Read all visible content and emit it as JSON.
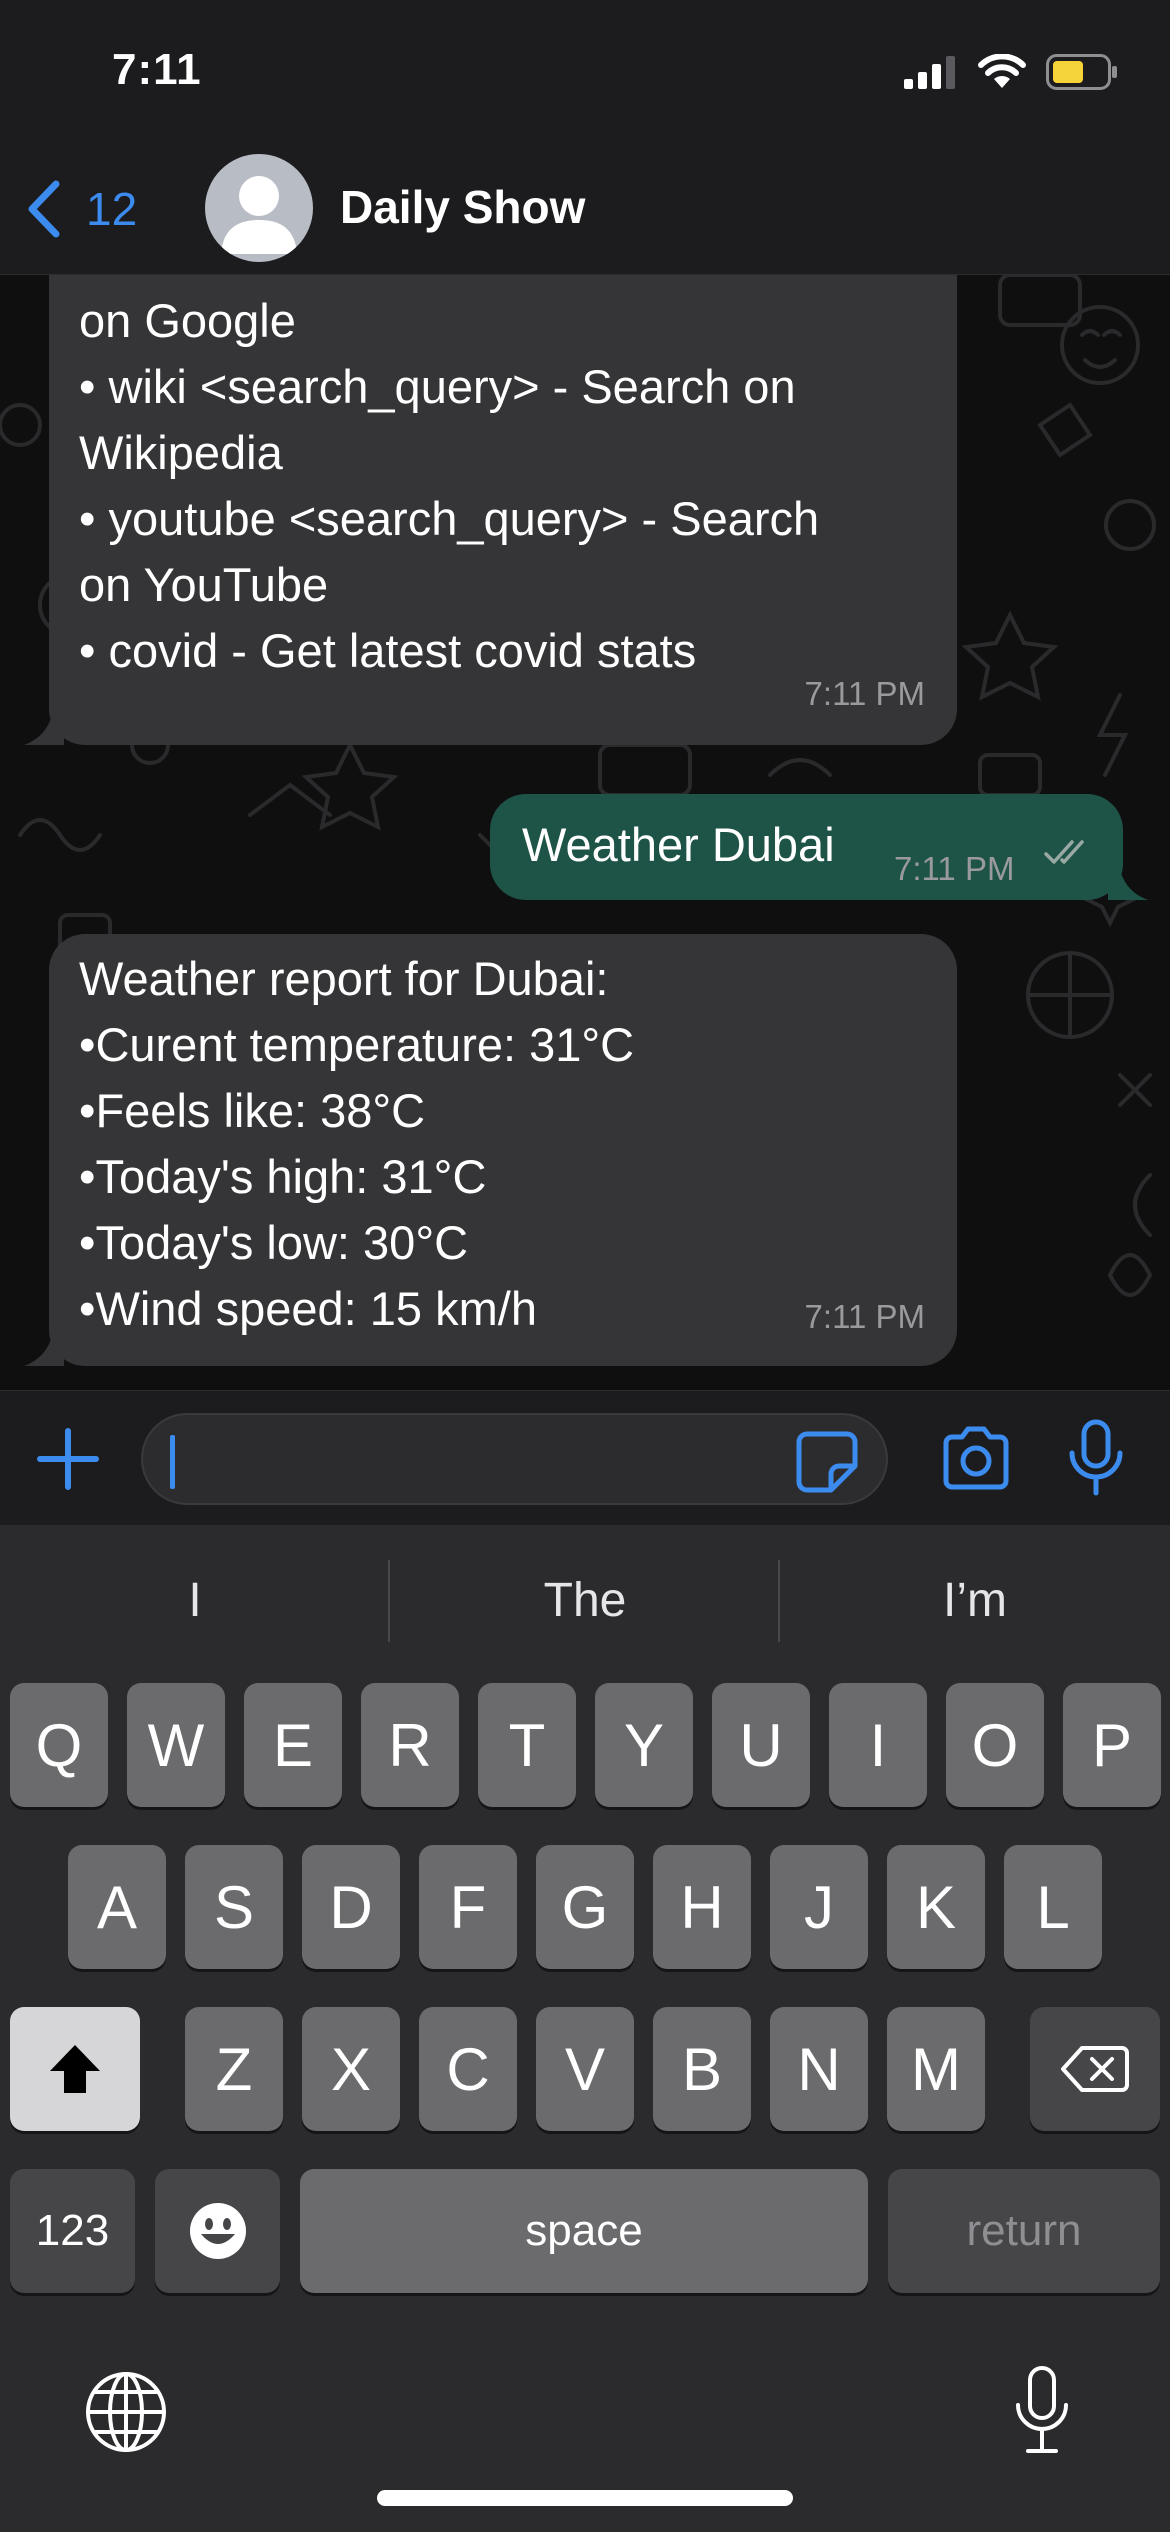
{
  "status_bar": {
    "time": "7:11",
    "icons": [
      "signal-icon",
      "wifi-icon",
      "battery-icon"
    ]
  },
  "header": {
    "back_count": "12",
    "title": "Daily Show",
    "icons": [
      "back-chevron-icon",
      "avatar-placeholder-icon"
    ]
  },
  "messages": [
    {
      "direction": "incoming",
      "lines": [
        "on Google",
        "• wiki <search_query> - Search on",
        "Wikipedia",
        "• youtube <search_query> - Search",
        "on YouTube",
        "• covid - Get latest covid stats"
      ],
      "time": "7:11 PM"
    },
    {
      "direction": "outgoing",
      "lines": [
        "Weather Dubai"
      ],
      "time": "7:11 PM",
      "status": "read"
    },
    {
      "direction": "incoming",
      "lines": [
        "Weather report for Dubai:",
        "•Curent temperature: 31°C",
        "•Feels like: 38°C",
        "•Today's high: 31°C",
        "•Today's low: 30°C",
        "•Wind speed: 15 km/h"
      ],
      "time": "7:11 PM"
    }
  ],
  "composer": {
    "input_value": "",
    "icons": [
      "plus-icon",
      "sticker-icon",
      "camera-icon",
      "microphone-icon"
    ]
  },
  "keyboard": {
    "suggestions": [
      "I",
      "The",
      "I’m"
    ],
    "row1": [
      "Q",
      "W",
      "E",
      "R",
      "T",
      "Y",
      "U",
      "I",
      "O",
      "P"
    ],
    "row2": [
      "A",
      "S",
      "D",
      "F",
      "G",
      "H",
      "J",
      "K",
      "L"
    ],
    "row3": [
      "Z",
      "X",
      "C",
      "V",
      "B",
      "N",
      "M"
    ],
    "numbers_label": "123",
    "space_label": "space",
    "return_label": "return",
    "icons": [
      "shift-icon",
      "backspace-icon",
      "emoji-icon",
      "globe-icon",
      "dictation-icon"
    ]
  },
  "colors": {
    "accent": "#3c8cf0",
    "incoming_bubble": "#353537",
    "outgoing_bubble": "#1d5447",
    "background": "#1c1c1e"
  }
}
